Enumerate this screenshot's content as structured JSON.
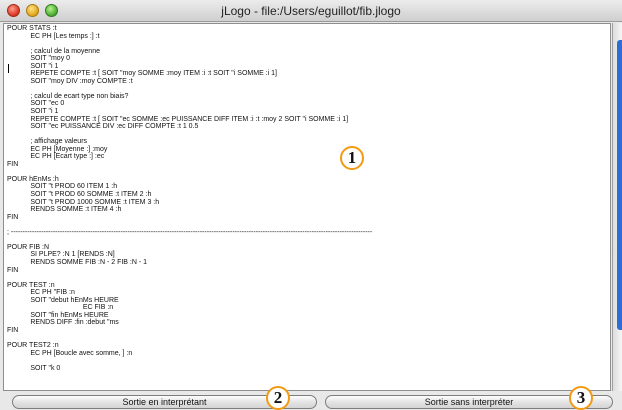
{
  "window": {
    "title": "jLogo - file:/Users/eguillot/fib.jlogo"
  },
  "editor": {
    "lines": [
      "POUR STATS :t",
      "            EC PH [Les temps :] :t",
      "",
      "            ; calcul de la moyenne",
      "            SOIT \"moy 0",
      "            SOIT \"i 1",
      "            REPETE COMPTE :t [ SOIT \"moy SOMME :moy ITEM :i :t SOIT \"i SOMME :i 1]",
      "            SOIT \"moy DIV :moy COMPTE :t",
      "",
      "            ; calcul de ecart type non biais?",
      "            SOIT \"ec 0",
      "            SOIT \"i 1",
      "            REPETE COMPTE :t [ SOIT \"ec SOMME :ec PUISSANCE DIFF ITEM :i :t :moy 2 SOIT \"i SOMME :i 1]",
      "            SOIT \"ec PUISSANCE DIV :ec DIFF COMPTE :t 1 0.5",
      "",
      "            ; affichage valeurs",
      "            EC PH [Moyenne :] :moy",
      "            EC PH [Ecart type :] :ec",
      "FIN",
      "",
      "POUR hEnMs :h",
      "            SOIT \"t PROD 60 ITEM 1 :h",
      "            SOIT \"t PROD 60 SOMME :t ITEM 2 :h",
      "            SOIT \"t PROD 1000 SOMME :t ITEM 3 :h",
      "            RENDS SOMME :t ITEM 4 :h",
      "FIN",
      "",
      "; -----------------------------------------------------------------------------------------------------------------------------------------------------------",
      "",
      "POUR FIB :N",
      "            SI PLPE? :N 1 [RENDS :N]",
      "            RENDS SOMME FIB :N - 2 FIB :N - 1",
      "FIN",
      "",
      "POUR TEST :n",
      "            EC PH \"FIB :n",
      "            SOIT \"debut hEnMs HEURE",
      "                                       EC FIB :n",
      "            SOIT \"fin hEnMs HEURE",
      "            RENDS DIFF :fin :debut \"ms",
      "FIN",
      "",
      "POUR TEST2 :n",
      "            EC PH [Boucle avec somme, ] :n",
      "",
      "            SOIT \"k 0"
    ]
  },
  "buttons": {
    "run_interpreting": "Sortie en interprétant",
    "run_not_interpreting": "Sortie sans interpréter"
  },
  "annotations": {
    "editor_marker": "1",
    "run_interpreting_marker": "2",
    "run_not_interpreting_marker": "3",
    "marker_color": "#f29a12"
  }
}
